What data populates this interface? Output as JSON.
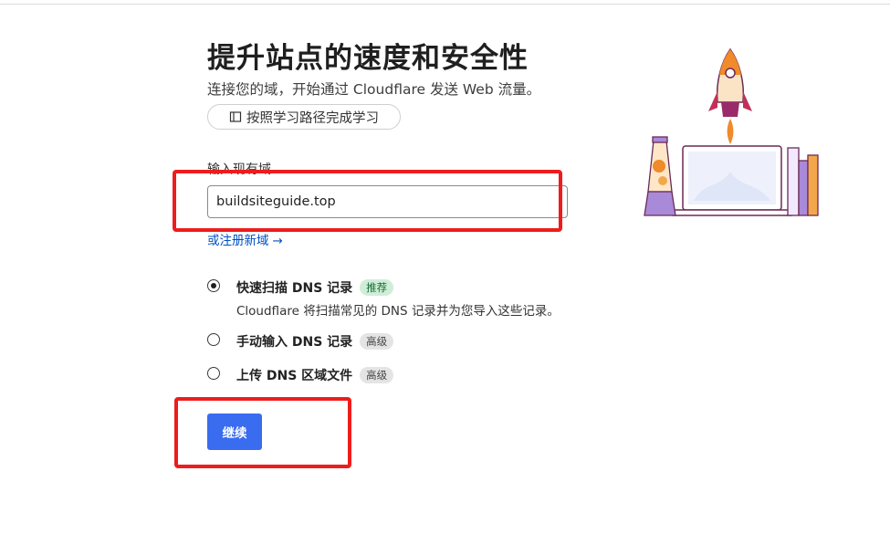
{
  "header": {
    "title": "提升站点的速度和安全性",
    "subtitle": "连接您的域，开始通过 Cloudflare 发送 Web 流量。",
    "learn_button": "按照学习路径完成学习"
  },
  "domain_form": {
    "label": "输入现有域",
    "value": "buildsiteguide.top",
    "register_link": "或注册新域",
    "register_arrow": "→"
  },
  "dns_options": [
    {
      "title": "快速扫描 DNS 记录",
      "badge": "推荐",
      "description": "Cloudflare 将扫描常见的 DNS 记录并为您导入这些记录。",
      "selected": true
    },
    {
      "title": "手动输入 DNS 记录",
      "badge": "高级",
      "selected": false
    },
    {
      "title": "上传 DNS 区域文件",
      "badge": "高级",
      "selected": false
    }
  ],
  "actions": {
    "continue": "继续"
  },
  "colors": {
    "primary": "#3a6cf0",
    "link": "#0051c3",
    "annotation": "#ee1c1c",
    "badge_recommended": "#cfeed8",
    "badge_advanced": "#e4e4e4"
  },
  "icons": {
    "learn": "book-icon",
    "illustration": "rocket-laptop-illustration"
  }
}
